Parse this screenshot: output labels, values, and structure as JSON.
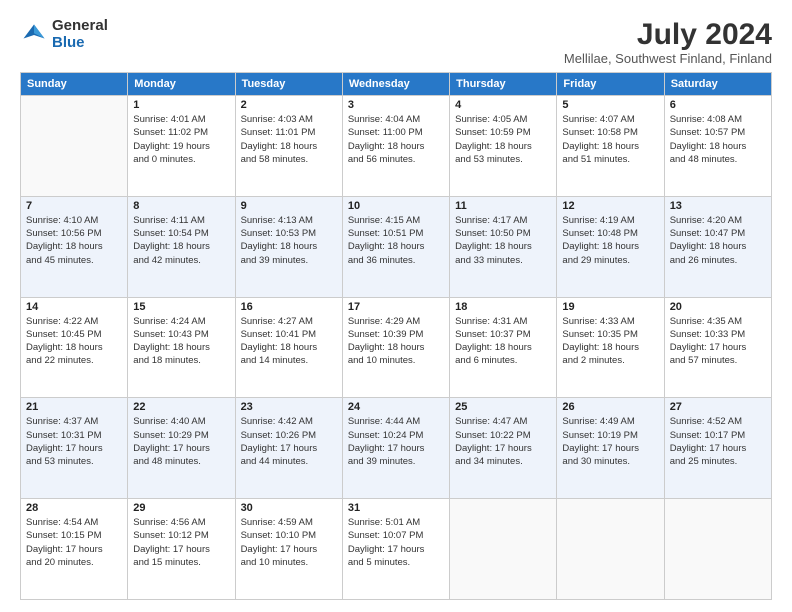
{
  "logo": {
    "general": "General",
    "blue": "Blue"
  },
  "title": "July 2024",
  "subtitle": "Mellilae, Southwest Finland, Finland",
  "headers": [
    "Sunday",
    "Monday",
    "Tuesday",
    "Wednesday",
    "Thursday",
    "Friday",
    "Saturday"
  ],
  "weeks": [
    [
      {
        "day": "",
        "info": ""
      },
      {
        "day": "1",
        "info": "Sunrise: 4:01 AM\nSunset: 11:02 PM\nDaylight: 19 hours\nand 0 minutes."
      },
      {
        "day": "2",
        "info": "Sunrise: 4:03 AM\nSunset: 11:01 PM\nDaylight: 18 hours\nand 58 minutes."
      },
      {
        "day": "3",
        "info": "Sunrise: 4:04 AM\nSunset: 11:00 PM\nDaylight: 18 hours\nand 56 minutes."
      },
      {
        "day": "4",
        "info": "Sunrise: 4:05 AM\nSunset: 10:59 PM\nDaylight: 18 hours\nand 53 minutes."
      },
      {
        "day": "5",
        "info": "Sunrise: 4:07 AM\nSunset: 10:58 PM\nDaylight: 18 hours\nand 51 minutes."
      },
      {
        "day": "6",
        "info": "Sunrise: 4:08 AM\nSunset: 10:57 PM\nDaylight: 18 hours\nand 48 minutes."
      }
    ],
    [
      {
        "day": "7",
        "info": "Sunrise: 4:10 AM\nSunset: 10:56 PM\nDaylight: 18 hours\nand 45 minutes."
      },
      {
        "day": "8",
        "info": "Sunrise: 4:11 AM\nSunset: 10:54 PM\nDaylight: 18 hours\nand 42 minutes."
      },
      {
        "day": "9",
        "info": "Sunrise: 4:13 AM\nSunset: 10:53 PM\nDaylight: 18 hours\nand 39 minutes."
      },
      {
        "day": "10",
        "info": "Sunrise: 4:15 AM\nSunset: 10:51 PM\nDaylight: 18 hours\nand 36 minutes."
      },
      {
        "day": "11",
        "info": "Sunrise: 4:17 AM\nSunset: 10:50 PM\nDaylight: 18 hours\nand 33 minutes."
      },
      {
        "day": "12",
        "info": "Sunrise: 4:19 AM\nSunset: 10:48 PM\nDaylight: 18 hours\nand 29 minutes."
      },
      {
        "day": "13",
        "info": "Sunrise: 4:20 AM\nSunset: 10:47 PM\nDaylight: 18 hours\nand 26 minutes."
      }
    ],
    [
      {
        "day": "14",
        "info": "Sunrise: 4:22 AM\nSunset: 10:45 PM\nDaylight: 18 hours\nand 22 minutes."
      },
      {
        "day": "15",
        "info": "Sunrise: 4:24 AM\nSunset: 10:43 PM\nDaylight: 18 hours\nand 18 minutes."
      },
      {
        "day": "16",
        "info": "Sunrise: 4:27 AM\nSunset: 10:41 PM\nDaylight: 18 hours\nand 14 minutes."
      },
      {
        "day": "17",
        "info": "Sunrise: 4:29 AM\nSunset: 10:39 PM\nDaylight: 18 hours\nand 10 minutes."
      },
      {
        "day": "18",
        "info": "Sunrise: 4:31 AM\nSunset: 10:37 PM\nDaylight: 18 hours\nand 6 minutes."
      },
      {
        "day": "19",
        "info": "Sunrise: 4:33 AM\nSunset: 10:35 PM\nDaylight: 18 hours\nand 2 minutes."
      },
      {
        "day": "20",
        "info": "Sunrise: 4:35 AM\nSunset: 10:33 PM\nDaylight: 17 hours\nand 57 minutes."
      }
    ],
    [
      {
        "day": "21",
        "info": "Sunrise: 4:37 AM\nSunset: 10:31 PM\nDaylight: 17 hours\nand 53 minutes."
      },
      {
        "day": "22",
        "info": "Sunrise: 4:40 AM\nSunset: 10:29 PM\nDaylight: 17 hours\nand 48 minutes."
      },
      {
        "day": "23",
        "info": "Sunrise: 4:42 AM\nSunset: 10:26 PM\nDaylight: 17 hours\nand 44 minutes."
      },
      {
        "day": "24",
        "info": "Sunrise: 4:44 AM\nSunset: 10:24 PM\nDaylight: 17 hours\nand 39 minutes."
      },
      {
        "day": "25",
        "info": "Sunrise: 4:47 AM\nSunset: 10:22 PM\nDaylight: 17 hours\nand 34 minutes."
      },
      {
        "day": "26",
        "info": "Sunrise: 4:49 AM\nSunset: 10:19 PM\nDaylight: 17 hours\nand 30 minutes."
      },
      {
        "day": "27",
        "info": "Sunrise: 4:52 AM\nSunset: 10:17 PM\nDaylight: 17 hours\nand 25 minutes."
      }
    ],
    [
      {
        "day": "28",
        "info": "Sunrise: 4:54 AM\nSunset: 10:15 PM\nDaylight: 17 hours\nand 20 minutes."
      },
      {
        "day": "29",
        "info": "Sunrise: 4:56 AM\nSunset: 10:12 PM\nDaylight: 17 hours\nand 15 minutes."
      },
      {
        "day": "30",
        "info": "Sunrise: 4:59 AM\nSunset: 10:10 PM\nDaylight: 17 hours\nand 10 minutes."
      },
      {
        "day": "31",
        "info": "Sunrise: 5:01 AM\nSunset: 10:07 PM\nDaylight: 17 hours\nand 5 minutes."
      },
      {
        "day": "",
        "info": ""
      },
      {
        "day": "",
        "info": ""
      },
      {
        "day": "",
        "info": ""
      }
    ]
  ]
}
